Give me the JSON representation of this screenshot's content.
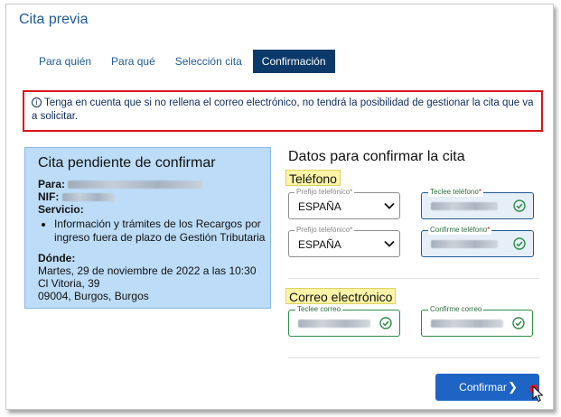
{
  "window": {
    "title": "Cita previa"
  },
  "tabs": [
    {
      "label": "Para quién"
    },
    {
      "label": "Para qué"
    },
    {
      "label": "Selección cita"
    },
    {
      "label": "Confirmación"
    }
  ],
  "alert": {
    "text": "Tenga en cuenta que si no rellena el correo electrónico, no tendrá la posibilidad de gestionar la cita que va a solicitar."
  },
  "summary": {
    "title": "Cita pendiente de confirmar",
    "para_label": "Para:",
    "nif_label": "NIF:",
    "servicio_label": "Servicio:",
    "servicio_item": "Información y trámites de los Recargos por ingreso fuera de plazo de Gestión Tributaria",
    "donde_label": "Dónde:",
    "donde_lines": [
      "Martes, 29 de noviembre de 2022 a las 10:30",
      "Cl Vitoria, 39",
      "09004, Burgos, Burgos"
    ]
  },
  "form": {
    "title": "Datos para confirmar la cita",
    "telefono_heading": "Teléfono",
    "prefix1": {
      "label": "Prefijo telefónico",
      "value": "ESPAÑA"
    },
    "phone1": {
      "label": "Teclee teléfono"
    },
    "prefix2": {
      "label": "Prefijo telefónico",
      "value": "ESPAÑA"
    },
    "phone2": {
      "label": "Confirme teléfono"
    },
    "correo_heading": "Correo electrónico",
    "email1": {
      "label": "Teclee correo"
    },
    "email2": {
      "label": "Confirme correo"
    },
    "required_mark": "*"
  },
  "actions": {
    "confirm_label": "Confirmar",
    "confirm_arrow": "❯"
  },
  "colors": {
    "primary": "#1f5a96",
    "tab_active": "#0b3a6a",
    "alert_border": "#d9141b",
    "summary_bg": "#bcdcf7",
    "highlight": "#fdf4a8",
    "valid": "#2e8b4a",
    "button": "#1d64c4"
  }
}
